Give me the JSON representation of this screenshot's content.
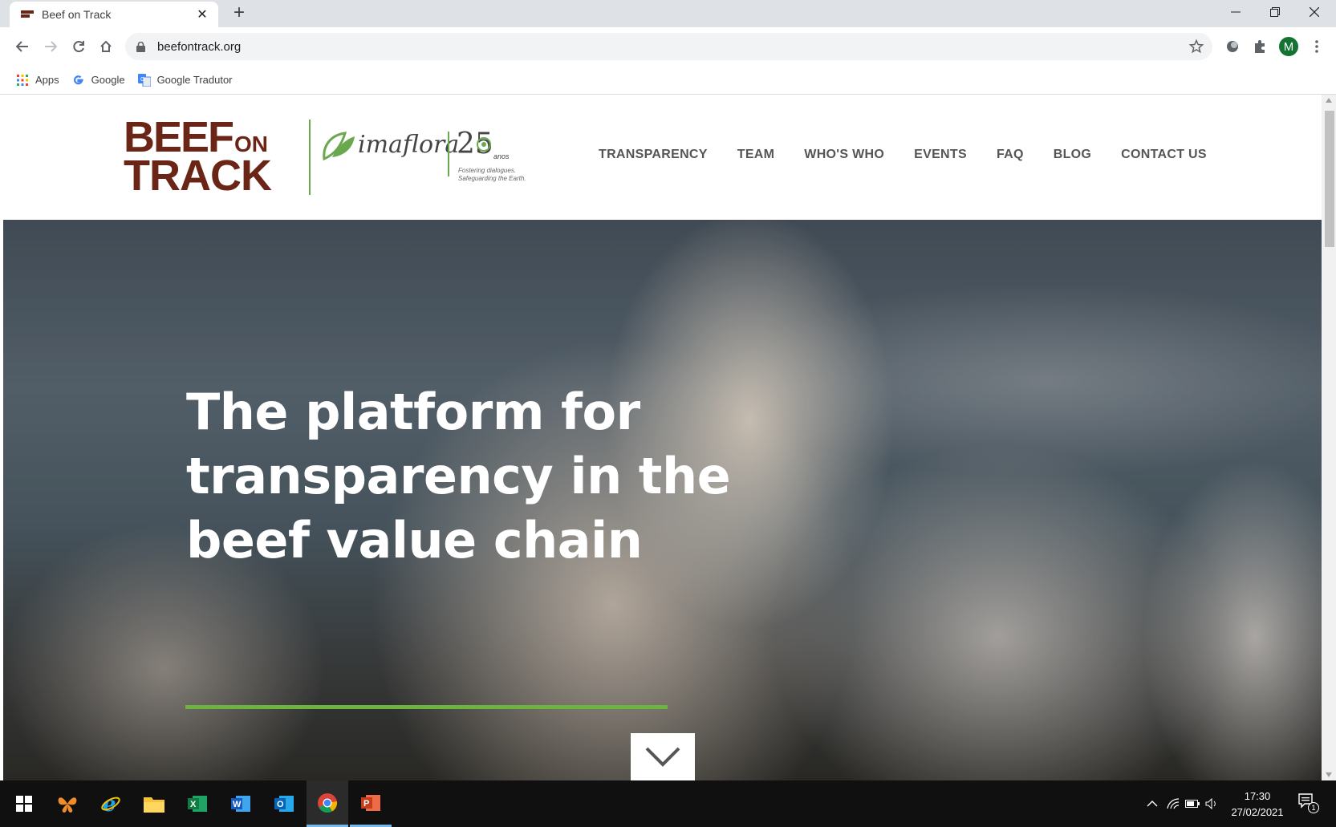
{
  "browser": {
    "tab_title": "Beef on Track",
    "url": "beefontrack.org",
    "profile_initial": "M",
    "bookmarks": [
      {
        "label": "Apps",
        "icon": "apps-grid-icon"
      },
      {
        "label": "Google",
        "icon": "google-icon"
      },
      {
        "label": "Google Tradutor",
        "icon": "google-translate-icon"
      }
    ]
  },
  "site": {
    "logo": {
      "line1": "BEEF",
      "on": "ON",
      "line2": "TRACK"
    },
    "partner": {
      "name": "imaflora",
      "anniversary": "25",
      "anniversary_label": "anos",
      "tagline": "Fostering dialogues. Safeguarding the Earth."
    },
    "nav": [
      "TRANSPARENCY",
      "TEAM",
      "WHO'S WHO",
      "EVENTS",
      "FAQ",
      "BLOG",
      "CONTACT US"
    ],
    "hero": {
      "title": "The platform for transparency in the beef value chain"
    }
  },
  "taskbar": {
    "time": "17:30",
    "date": "27/02/2021",
    "notification_count": "1"
  },
  "colors": {
    "brand_brown": "#6b2517",
    "brand_green": "#6cb33f",
    "nav_text": "#555555"
  }
}
